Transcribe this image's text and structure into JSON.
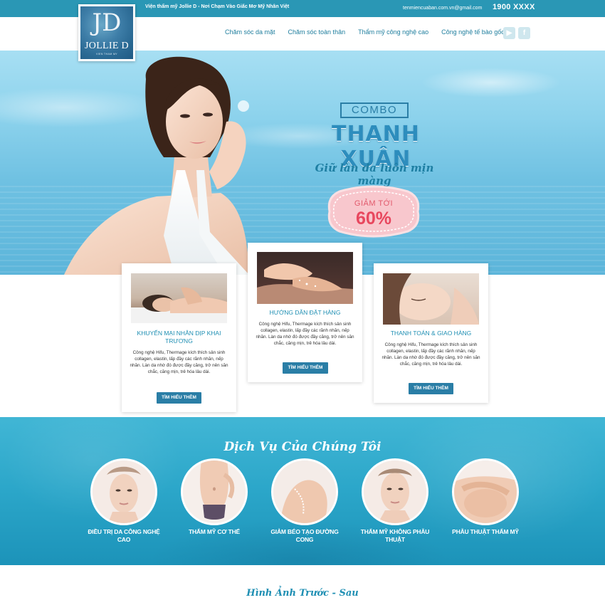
{
  "topbar": {
    "slogan": "Viện thẩm mỹ Jollie D - Nơi Chạm Vào Giấc Mơ Mỹ Nhân Việt",
    "email": "tenmiencuaban.com.vn@gmail.com",
    "phone": "1900 XXXX"
  },
  "logo": {
    "monogram": "JD",
    "name": "JOLLIE D",
    "subtitle": "VIEN THAM MY"
  },
  "nav": {
    "items": [
      {
        "label": "Chăm sóc da mặt"
      },
      {
        "label": "Chăm sóc toàn thân"
      },
      {
        "label": "Thẩm mỹ công nghệ cao"
      },
      {
        "label": "Công nghệ tế bào gốc"
      }
    ],
    "social_icons": [
      "youtube-icon",
      "facebook-icon"
    ]
  },
  "hero": {
    "combo": "COMBO",
    "title": "THANH XUÂN",
    "tagline": "Giữ làn da luôn mịn màng",
    "badge_label": "GIẢM TỚI",
    "badge_value": "60%"
  },
  "cards": [
    {
      "title": "KHUYẾN MẠI NHÂN DỊP KHAI TRƯƠNG",
      "text": "Công nghệ Hifu, Thermage kích thích sản sinh collagen, elastin, lấp đầy các rãnh nhăn, nếp nhăn. Làn da nhờ đó được đầy căng, trở nên săn chắc, căng mịn, trẻ hóa lâu dài.",
      "button": "TÌM HIỂU THÊM"
    },
    {
      "title": "HƯỚNG DẪN ĐẶT HÀNG",
      "text": "Công nghệ Hifu, Thermage kích thích sản sinh collagen, elastin, lấp đầy các rãnh nhăn, nếp nhăn. Làn da nhờ đó được đầy căng, trở nên săn chắc, căng mịn, trẻ hóa lâu dài.",
      "button": "TÌM HIỂU THÊM"
    },
    {
      "title": "THANH TOÁN & GIAO HÀNG",
      "text": "Công nghệ Hifu, Thermage kích thích sản sinh collagen, elastin, lấp đầy các rãnh nhăn, nếp nhăn. Làn da nhờ đó được đầy căng, trở nên săn chắc, căng mịn, trẻ hóa lâu dài.",
      "button": "TÌM HIỂU THÊM"
    }
  ],
  "services": {
    "title": "Dịch Vụ Của Chúng Tôi",
    "items": [
      {
        "label": "ĐIỀU TRỊ DA CÔNG NGHỆ CAO"
      },
      {
        "label": "THẨM MỸ CƠ THỂ"
      },
      {
        "label": "GIẢM BÉO TẠO ĐƯỜNG CONG"
      },
      {
        "label": "THẨM MỸ KHÔNG PHẪU THUẬT"
      },
      {
        "label": "PHẪU THUẬT THẨM MỸ"
      }
    ]
  },
  "before_after": {
    "title": "Hình Ảnh Trước - Sau"
  },
  "colors": {
    "brand": "#2a97b5",
    "accent": "#2a7ea6",
    "badge": "#e8475e"
  }
}
